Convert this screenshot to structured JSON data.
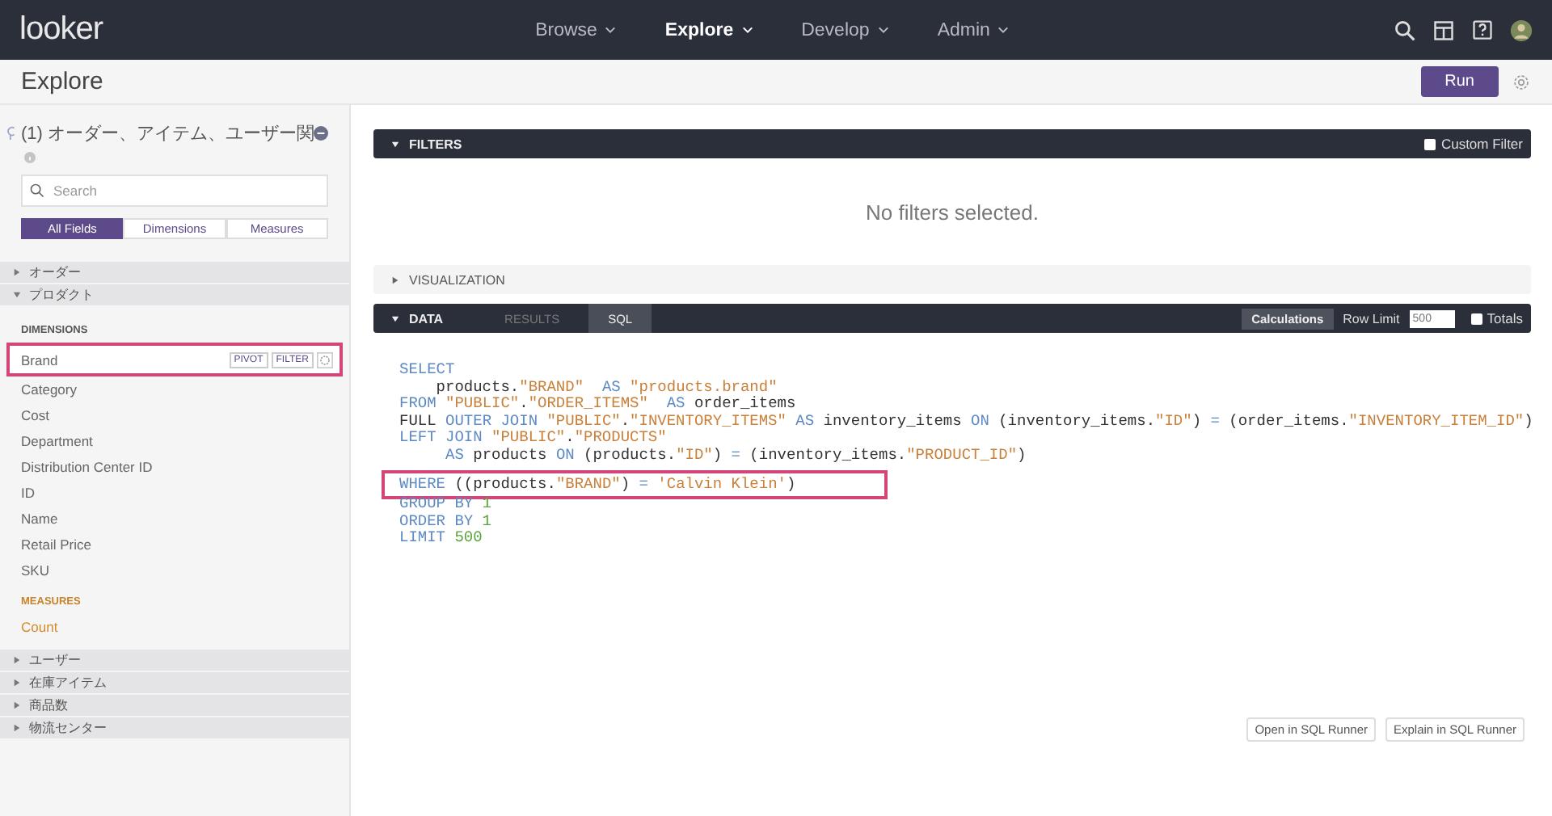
{
  "nav": {
    "logo": "looker",
    "menus": [
      {
        "label": "Browse",
        "selected": false
      },
      {
        "label": "Explore",
        "selected": true
      },
      {
        "label": "Develop",
        "selected": false
      },
      {
        "label": "Admin",
        "selected": false
      }
    ]
  },
  "header": {
    "title": "Explore",
    "run_button": "Run"
  },
  "sidebar": {
    "explore_title": "(1) オーダー、アイテム、ユーザー関",
    "search": {
      "placeholder": "Search"
    },
    "tabs": [
      {
        "label": "All Fields",
        "selected": true
      },
      {
        "label": "Dimensions",
        "selected": false
      },
      {
        "label": "Measures",
        "selected": false
      }
    ],
    "views": [
      {
        "label": "オーダー",
        "expanded": false
      },
      {
        "label": "プロダクト",
        "expanded": true,
        "sections": [
          {
            "kind": "dimensions",
            "heading": "DIMENSIONS",
            "fields": [
              {
                "label": "Brand",
                "highlighted": true,
                "actions": [
                  "PIVOT",
                  "FILTER"
                ]
              },
              {
                "label": "Category",
                "highlighted": false
              },
              {
                "label": "Cost",
                "highlighted": false
              },
              {
                "label": "Department",
                "highlighted": false
              },
              {
                "label": "Distribution Center ID",
                "highlighted": false
              },
              {
                "label": "ID",
                "highlighted": false
              },
              {
                "label": "Name",
                "highlighted": false
              },
              {
                "label": "Retail Price",
                "highlighted": false
              },
              {
                "label": "SKU",
                "highlighted": false
              }
            ]
          },
          {
            "kind": "measures",
            "heading": "MEASURES",
            "fields": [
              {
                "label": "Count",
                "highlighted": false
              }
            ]
          }
        ]
      },
      {
        "label": "ユーザー",
        "expanded": false
      },
      {
        "label": "在庫アイテム",
        "expanded": false
      },
      {
        "label": "商品数",
        "expanded": false
      },
      {
        "label": "物流センター",
        "expanded": false
      }
    ]
  },
  "filters": {
    "title": "FILTERS",
    "expanded": true,
    "custom_filter": {
      "label": "Custom Filter",
      "checked": false
    },
    "empty_message": "No filters selected."
  },
  "visualization": {
    "title": "VISUALIZATION",
    "expanded": false
  },
  "data": {
    "title": "DATA",
    "expanded": true,
    "tabs": [
      {
        "label": "RESULTS",
        "selected": false
      },
      {
        "label": "SQL",
        "selected": true
      }
    ],
    "calculations": "Calculations",
    "row_limit": {
      "label": "Row Limit",
      "value": "500"
    },
    "totals": {
      "label": "Totals",
      "checked": false
    },
    "sql_lines": [
      {
        "highlighted": false,
        "tokens": [
          {
            "kind": "keyword",
            "text": "SELECT"
          }
        ]
      },
      {
        "highlighted": false,
        "tokens": [
          {
            "kind": "plain",
            "text": "    products."
          },
          {
            "kind": "string",
            "text": "\"BRAND\""
          },
          {
            "kind": "keyword",
            "text": "  AS"
          },
          {
            "kind": "string",
            "text": " \"products.brand\""
          }
        ]
      },
      {
        "highlighted": false,
        "tokens": [
          {
            "kind": "keyword",
            "text": "FROM"
          },
          {
            "kind": "string",
            "text": " \"PUBLIC\""
          },
          {
            "kind": "plain",
            "text": "."
          },
          {
            "kind": "string",
            "text": "\"ORDER_ITEMS\""
          },
          {
            "kind": "keyword",
            "text": "  AS"
          },
          {
            "kind": "plain",
            "text": " order_items"
          }
        ]
      },
      {
        "highlighted": false,
        "tokens": [
          {
            "kind": "plain",
            "text": "FULL "
          },
          {
            "kind": "keyword",
            "text": "OUTER JOIN"
          },
          {
            "kind": "string",
            "text": " \"PUBLIC\""
          },
          {
            "kind": "plain",
            "text": "."
          },
          {
            "kind": "string",
            "text": "\"INVENTORY_ITEMS\""
          },
          {
            "kind": "keyword",
            "text": " AS"
          },
          {
            "kind": "plain",
            "text": " inventory_items "
          },
          {
            "kind": "keyword",
            "text": "ON"
          },
          {
            "kind": "plain",
            "text": " (inventory_items."
          },
          {
            "kind": "string",
            "text": "\"ID\""
          },
          {
            "kind": "plain",
            "text": ") "
          },
          {
            "kind": "keyword",
            "text": "="
          },
          {
            "kind": "plain",
            "text": " (order_items."
          },
          {
            "kind": "string",
            "text": "\"INVENTORY_ITEM_ID\""
          },
          {
            "kind": "plain",
            "text": ")"
          }
        ]
      },
      {
        "highlighted": false,
        "tokens": [
          {
            "kind": "keyword",
            "text": "LEFT JOIN"
          },
          {
            "kind": "string",
            "text": " \"PUBLIC\""
          },
          {
            "kind": "plain",
            "text": "."
          },
          {
            "kind": "string",
            "text": "\"PRODUCTS\""
          }
        ]
      },
      {
        "highlighted": false,
        "tokens": [
          {
            "kind": "keyword",
            "text": "     AS"
          },
          {
            "kind": "plain",
            "text": " products "
          },
          {
            "kind": "keyword",
            "text": "ON"
          },
          {
            "kind": "plain",
            "text": " (products."
          },
          {
            "kind": "string",
            "text": "\"ID\""
          },
          {
            "kind": "plain",
            "text": ") "
          },
          {
            "kind": "keyword",
            "text": "="
          },
          {
            "kind": "plain",
            "text": " (inventory_items."
          },
          {
            "kind": "string",
            "text": "\"PRODUCT_ID\""
          },
          {
            "kind": "plain",
            "text": ")"
          }
        ]
      },
      {
        "highlighted": true,
        "tokens": [
          {
            "kind": "keyword",
            "text": "WHERE"
          },
          {
            "kind": "plain",
            "text": " ((products."
          },
          {
            "kind": "string",
            "text": "\"BRAND\""
          },
          {
            "kind": "plain",
            "text": ") "
          },
          {
            "kind": "keyword",
            "text": "="
          },
          {
            "kind": "string",
            "text": " 'Calvin Klein'"
          },
          {
            "kind": "plain",
            "text": ")"
          }
        ]
      },
      {
        "highlighted": false,
        "tokens": [
          {
            "kind": "keyword",
            "text": "GROUP BY"
          },
          {
            "kind": "number",
            "text": " 1"
          }
        ]
      },
      {
        "highlighted": false,
        "tokens": [
          {
            "kind": "keyword",
            "text": "ORDER BY"
          },
          {
            "kind": "number",
            "text": " 1"
          }
        ]
      },
      {
        "highlighted": false,
        "tokens": [
          {
            "kind": "keyword",
            "text": "LIMIT"
          },
          {
            "kind": "number",
            "text": " 500"
          }
        ]
      }
    ],
    "buttons": [
      "Open in SQL Runner",
      "Explain in SQL Runner"
    ]
  }
}
